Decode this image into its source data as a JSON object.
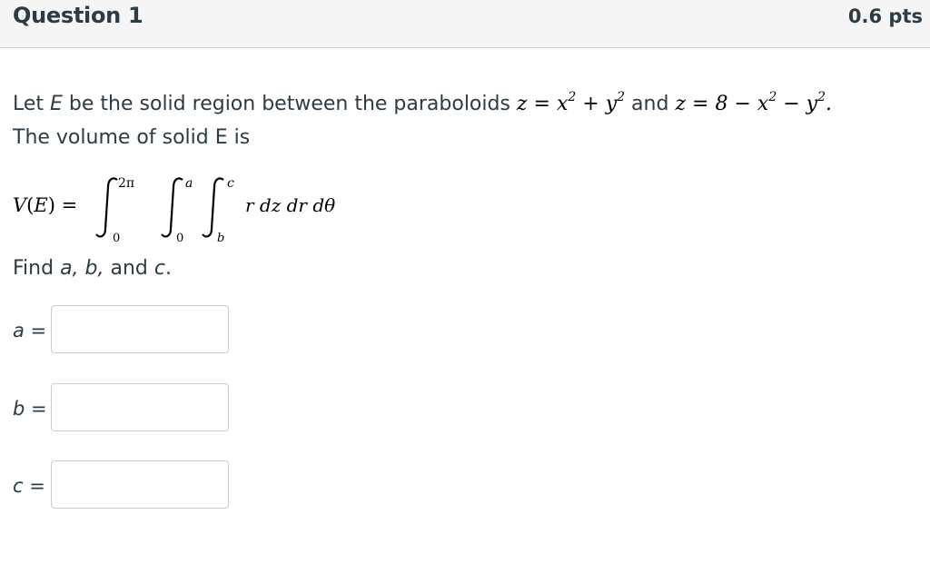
{
  "header": {
    "title": "Question 1",
    "points": "0.6 pts"
  },
  "question": {
    "line1_text_a": "Let ",
    "line1_var_E": "E",
    "line1_text_b": " be the solid region between the paraboloids ",
    "eq1_lhs": "z",
    "eq1_rhs": " = x",
    "eq1_rest": " + y",
    "line1_and": " and ",
    "eq2_lhs": "z",
    "eq2_rhs": " = 8 − x",
    "eq2_rest": " − y",
    "exp": "2",
    "period": ".",
    "line2": "The volume of solid E is",
    "integral": {
      "lhs": "V(E) =",
      "outer_upper": "2π",
      "outer_lower": "0",
      "middle_upper": "a",
      "middle_lower": "0",
      "inner_upper": "c",
      "inner_lower": "b",
      "integrand": "r dz dr dθ"
    },
    "find_a": "Find ",
    "find_vars": "a, b,",
    "find_and": " and ",
    "find_c": "c",
    "find_end": "."
  },
  "answers": [
    {
      "label_var": "a",
      "label_eq": " =",
      "value": "",
      "placeholder": ""
    },
    {
      "label_var": "b",
      "label_eq": " =",
      "value": "",
      "placeholder": ""
    },
    {
      "label_var": "c",
      "label_eq": " =",
      "value": "",
      "placeholder": ""
    }
  ]
}
